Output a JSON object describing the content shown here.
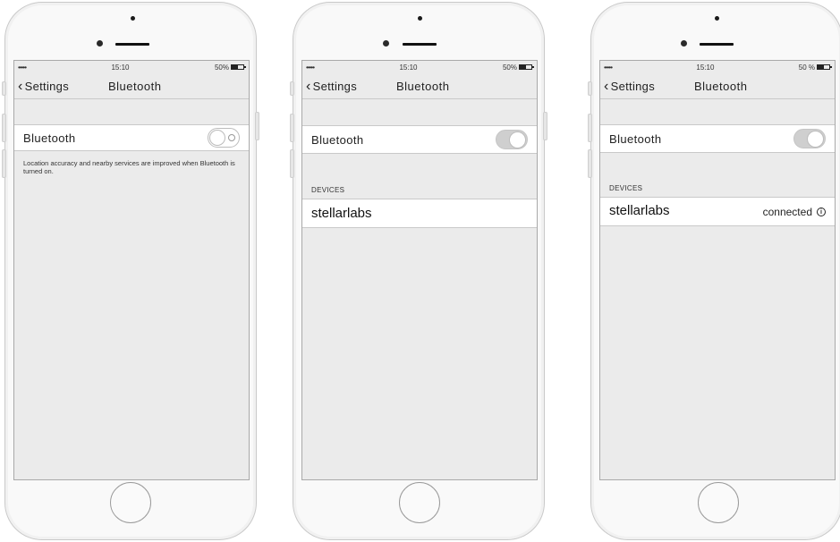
{
  "phones": [
    {
      "status": {
        "signal": "•••••",
        "time": "15:10",
        "battery": "50%"
      },
      "nav": {
        "back_label": "Settings",
        "title": "Bluetooth"
      },
      "bluetooth_row": {
        "label": "Bluetooth",
        "toggle_on": false
      },
      "footnote": "Location accuracy and nearby services are improved when Bluetooth is turned on."
    },
    {
      "status": {
        "signal": "•••••",
        "time": "15:10",
        "battery": "50%"
      },
      "nav": {
        "back_label": "Settings",
        "title": "Bluetooth"
      },
      "bluetooth_row": {
        "label": "Bluetooth",
        "toggle_on": true
      },
      "devices_header": "DEVICES",
      "devices": [
        {
          "name": "stellarlabs",
          "status": ""
        }
      ]
    },
    {
      "status": {
        "signal": "•••••",
        "time": "15:10",
        "battery": "50 %"
      },
      "nav": {
        "back_label": "Settings",
        "title": "Bluetooth"
      },
      "bluetooth_row": {
        "label": "Bluetooth",
        "toggle_on": true
      },
      "devices_header": "DEVICES",
      "devices": [
        {
          "name": "stellarlabs",
          "status": "connected",
          "icon": "info-icon"
        }
      ]
    }
  ]
}
